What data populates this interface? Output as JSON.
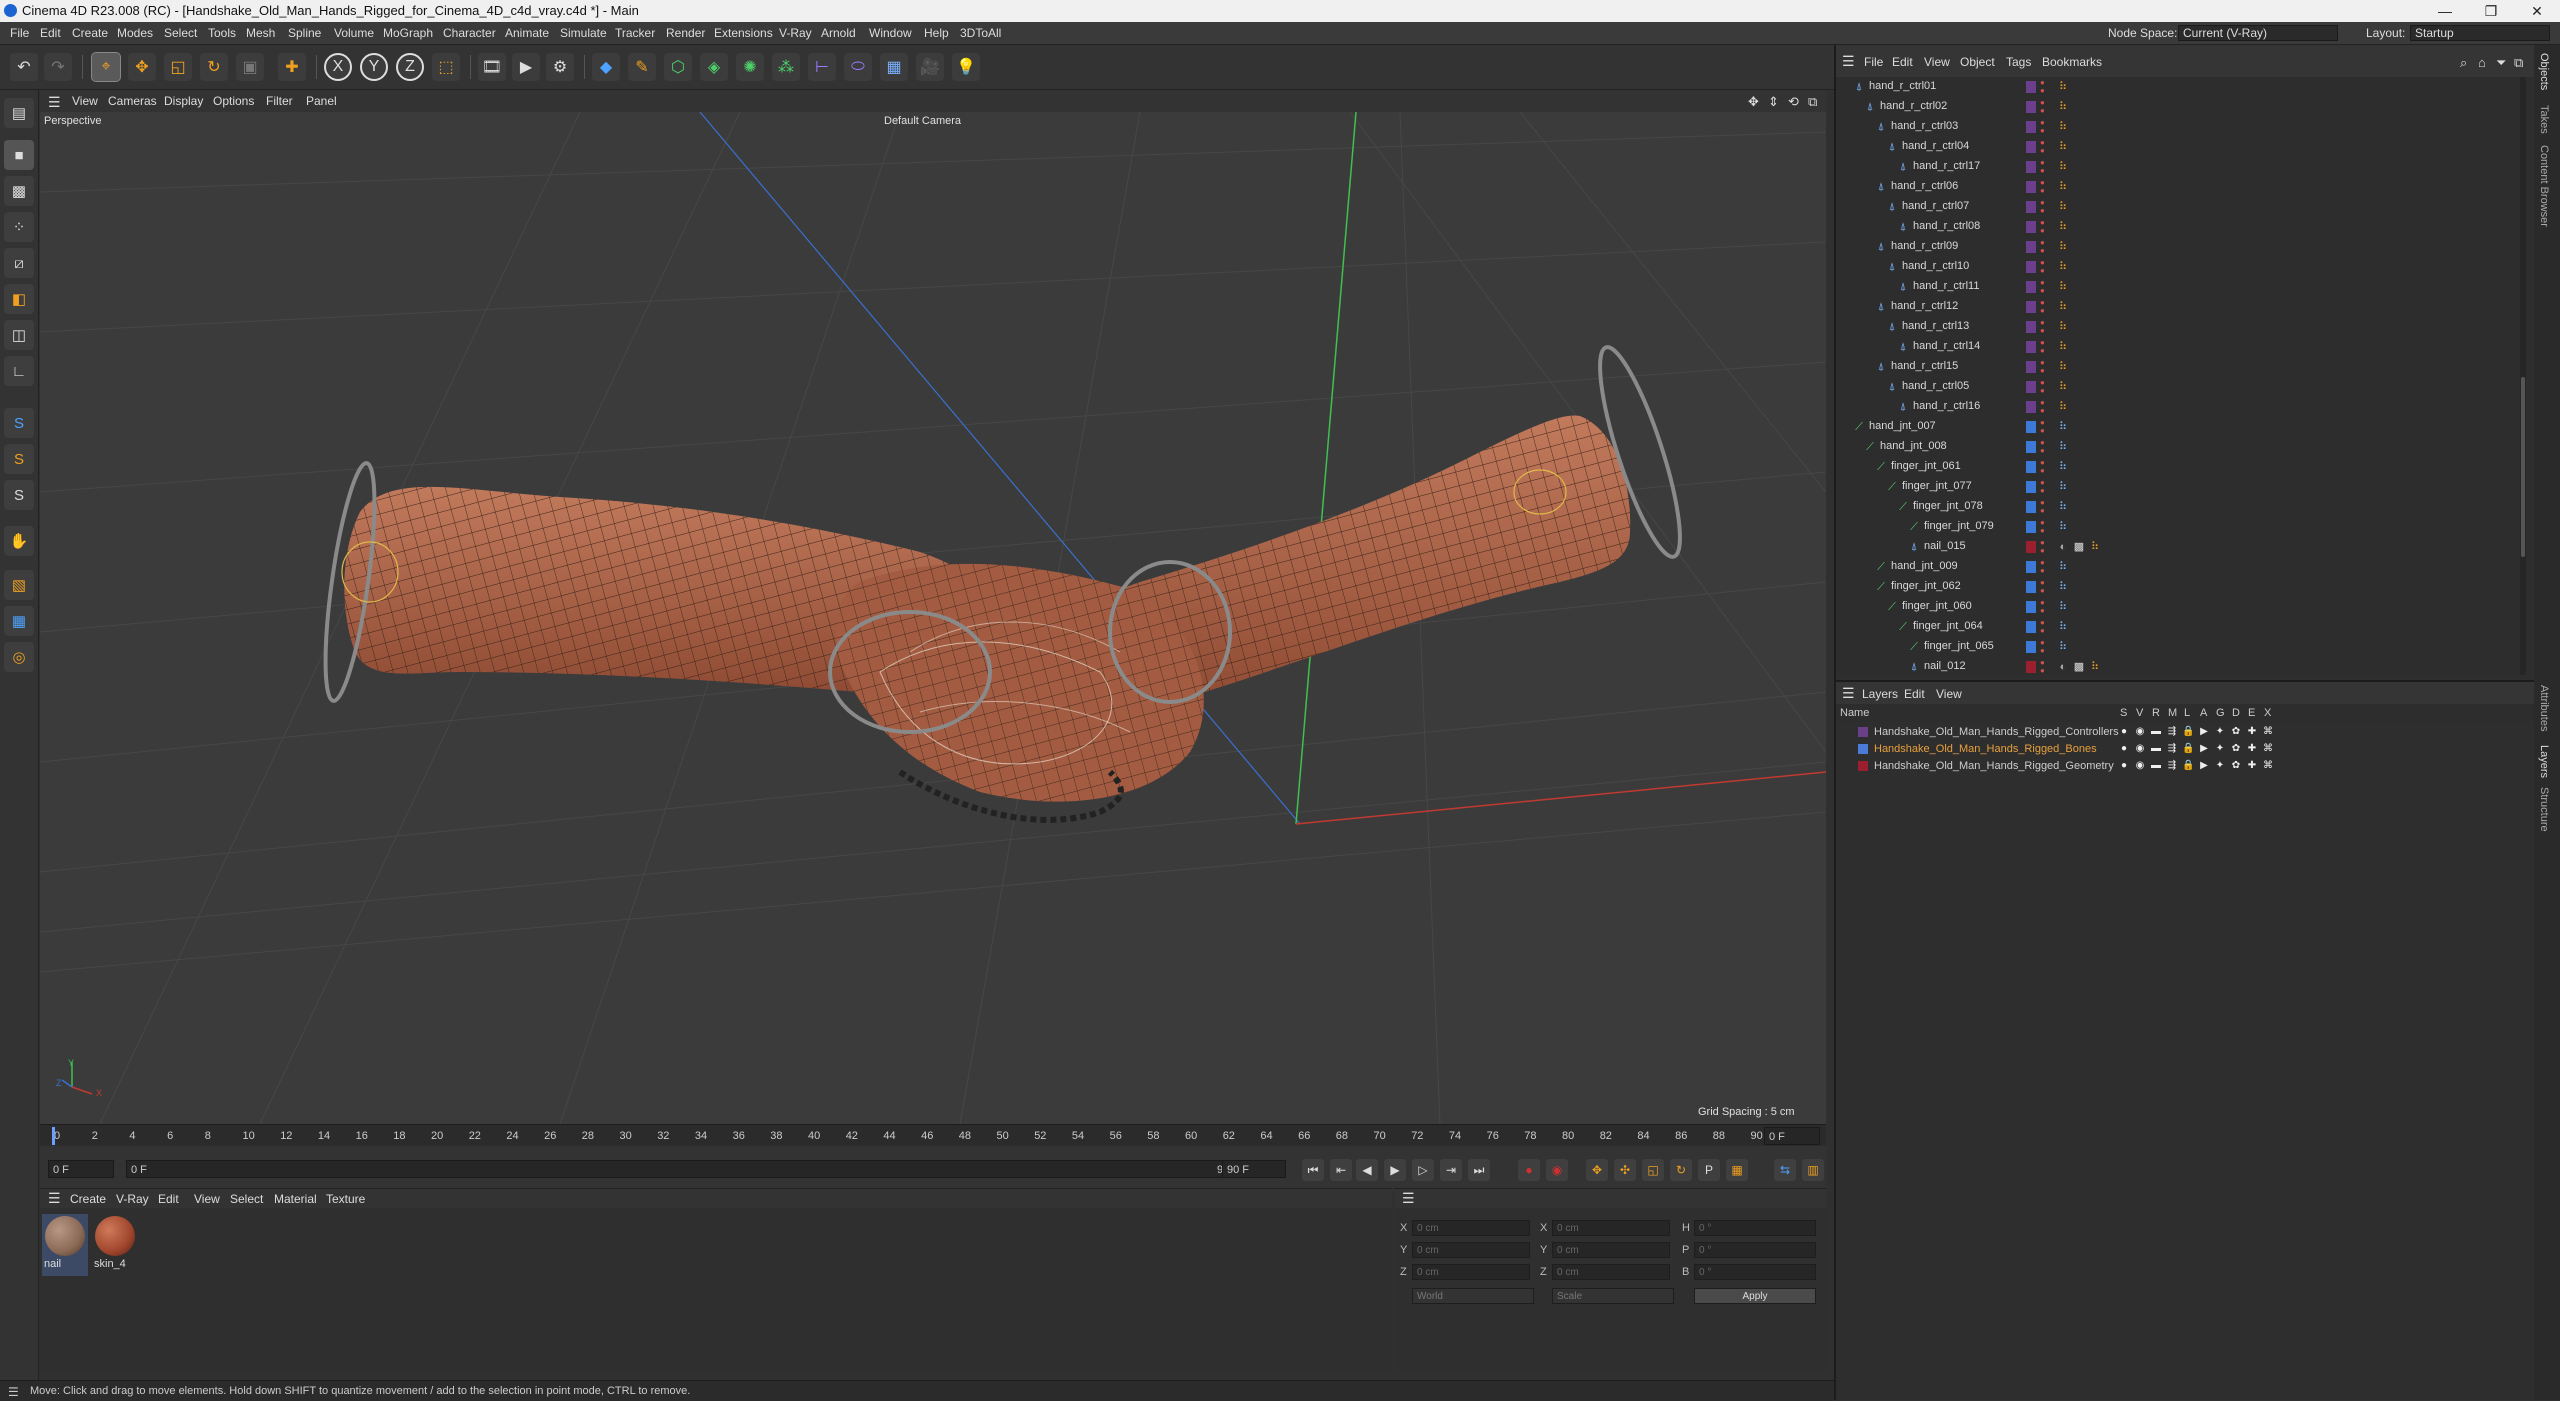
{
  "window": {
    "title": "Cinema 4D R23.008 (RC) - [Handshake_Old_Man_Hands_Rigged_for_Cinema_4D_c4d_vray.c4d *] - Main",
    "controls": [
      "—",
      "❐",
      "✕"
    ]
  },
  "menu": [
    "File",
    "Edit",
    "Create",
    "Modes",
    "Select",
    "Tools",
    "Mesh",
    "Spline",
    "Volume",
    "MoGraph",
    "Character",
    "Animate",
    "Simulate",
    "Tracker",
    "Render",
    "Extensions",
    "V-Ray",
    "Arnold",
    "Window",
    "Help",
    "3DToAll"
  ],
  "node_space": {
    "label": "Node Space:",
    "value": "Current (V-Ray)"
  },
  "layout": {
    "label": "Layout:",
    "value": "Startup"
  },
  "toolbar": {
    "axis_labels": [
      "X",
      "Y",
      "Z"
    ]
  },
  "viewport": {
    "menu": [
      "View",
      "Cameras",
      "Display",
      "Options",
      "Filter",
      "Panel"
    ],
    "name": "Perspective",
    "camera": "Default Camera",
    "grid_spacing": "Grid Spacing : 5 cm",
    "axis_y": "Y",
    "axis_z": "Z",
    "axis_x": "X"
  },
  "timeline": {
    "ticks": [
      "0",
      "2",
      "4",
      "6",
      "8",
      "10",
      "12",
      "14",
      "16",
      "18",
      "20",
      "22",
      "24",
      "26",
      "28",
      "30",
      "32",
      "34",
      "36",
      "38",
      "40",
      "42",
      "44",
      "46",
      "48",
      "50",
      "52",
      "54",
      "56",
      "58",
      "60",
      "62",
      "64",
      "66",
      "68",
      "70",
      "72",
      "74",
      "76",
      "78",
      "80",
      "82",
      "84",
      "86",
      "88",
      "90"
    ],
    "current_frame": "0 F",
    "start": "0 F",
    "preview_start": "0 F",
    "preview_end": "90 F",
    "end": "90 F"
  },
  "materials": {
    "menu": [
      "Create",
      "V-Ray",
      "Edit",
      "View",
      "Select",
      "Material",
      "Texture"
    ],
    "items": [
      {
        "name": "nail",
        "color": "#8a6a55"
      },
      {
        "name": "skin_4",
        "color": "#a0452c"
      }
    ]
  },
  "attributes": {
    "labels": {
      "x": "X",
      "y": "Y",
      "z": "Z",
      "x2": "X",
      "y2": "Y",
      "z2": "Z",
      "h": "H",
      "p": "P",
      "b": "B"
    },
    "values": {
      "pos": "0 cm",
      "size": "0 cm",
      "rot": "0 °"
    },
    "coord_mode": "World",
    "size_mode": "Scale",
    "apply": "Apply"
  },
  "status": "Move: Click and drag to move elements. Hold down SHIFT to quantize movement / add to the selection in point mode, CTRL to remove.",
  "object_manager": {
    "menu": [
      "File",
      "Edit",
      "View",
      "Object",
      "Tags",
      "Bookmarks"
    ],
    "rows": [
      {
        "name": "hand_r_ctrl01",
        "depth": 1,
        "type": "ctrl"
      },
      {
        "name": "hand_r_ctrl02",
        "depth": 2,
        "type": "ctrl"
      },
      {
        "name": "hand_r_ctrl03",
        "depth": 3,
        "type": "ctrl"
      },
      {
        "name": "hand_r_ctrl04",
        "depth": 4,
        "type": "ctrl"
      },
      {
        "name": "hand_r_ctrl17",
        "depth": 5,
        "type": "ctrl"
      },
      {
        "name": "hand_r_ctrl06",
        "depth": 3,
        "type": "ctrl"
      },
      {
        "name": "hand_r_ctrl07",
        "depth": 4,
        "type": "ctrl"
      },
      {
        "name": "hand_r_ctrl08",
        "depth": 5,
        "type": "ctrl"
      },
      {
        "name": "hand_r_ctrl09",
        "depth": 3,
        "type": "ctrl"
      },
      {
        "name": "hand_r_ctrl10",
        "depth": 4,
        "type": "ctrl"
      },
      {
        "name": "hand_r_ctrl11",
        "depth": 5,
        "type": "ctrl"
      },
      {
        "name": "hand_r_ctrl12",
        "depth": 3,
        "type": "ctrl"
      },
      {
        "name": "hand_r_ctrl13",
        "depth": 4,
        "type": "ctrl"
      },
      {
        "name": "hand_r_ctrl14",
        "depth": 5,
        "type": "ctrl"
      },
      {
        "name": "hand_r_ctrl15",
        "depth": 3,
        "type": "ctrl"
      },
      {
        "name": "hand_r_ctrl05",
        "depth": 4,
        "type": "ctrl"
      },
      {
        "name": "hand_r_ctrl16",
        "depth": 5,
        "type": "ctrl"
      },
      {
        "name": "hand_jnt_007",
        "depth": 1,
        "type": "joint"
      },
      {
        "name": "hand_jnt_008",
        "depth": 2,
        "type": "joint"
      },
      {
        "name": "finger_jnt_061",
        "depth": 3,
        "type": "joint"
      },
      {
        "name": "finger_jnt_077",
        "depth": 4,
        "type": "joint"
      },
      {
        "name": "finger_jnt_078",
        "depth": 5,
        "type": "joint"
      },
      {
        "name": "finger_jnt_079",
        "depth": 6,
        "type": "joint"
      },
      {
        "name": "nail_015",
        "depth": 6,
        "type": "mesh"
      },
      {
        "name": "hand_jnt_009",
        "depth": 3,
        "type": "joint"
      },
      {
        "name": "finger_jnt_062",
        "depth": 3,
        "type": "joint"
      },
      {
        "name": "finger_jnt_060",
        "depth": 4,
        "type": "joint"
      },
      {
        "name": "finger_jnt_064",
        "depth": 5,
        "type": "joint"
      },
      {
        "name": "finger_jnt_065",
        "depth": 6,
        "type": "joint"
      },
      {
        "name": "nail_012",
        "depth": 6,
        "type": "mesh"
      }
    ]
  },
  "layers": {
    "menu": [
      "Layers",
      "Edit",
      "View"
    ],
    "columns": [
      "Name",
      "S",
      "V",
      "R",
      "M",
      "L",
      "A",
      "G",
      "D",
      "E",
      "X"
    ],
    "rows": [
      {
        "name": "Handshake_Old_Man_Hands_Rigged_Controllers",
        "color": "#6a3f8a",
        "text_color": "#cccccc"
      },
      {
        "name": "Handshake_Old_Man_Hands_Rigged_Bones",
        "color": "#4b7ad8",
        "text_color": "#e8a03c"
      },
      {
        "name": "Handshake_Old_Man_Hands_Rigged_Geometry",
        "color": "#9a2030",
        "text_color": "#cccccc"
      }
    ]
  },
  "side_tabs": [
    "Objects",
    "Takes",
    "Content Browser",
    "Attributes",
    "Layers",
    "Structure"
  ],
  "colors": {
    "ctrl_swatch": "#6c3f8c",
    "joint_swatch": "#3d7ad8",
    "mesh_swatch": "#9a2030",
    "skin": "#b06a4e",
    "y_axis": "#3fc04f",
    "x_axis": "#c03a32",
    "z_axis": "#3a6fcf"
  }
}
